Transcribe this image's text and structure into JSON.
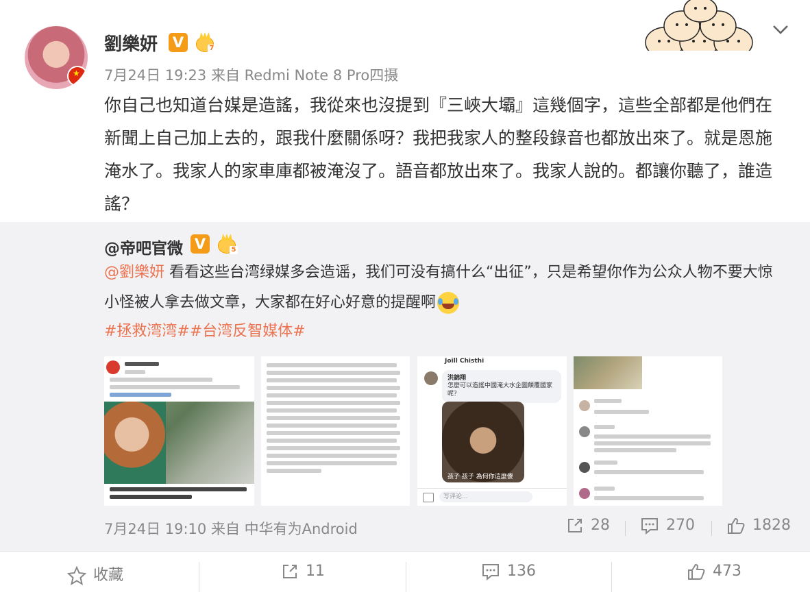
{
  "post": {
    "author": "劉樂妍",
    "level": "7",
    "time_source": "7月24日 19:23 来自 Redmi Note 8 Pro四摄",
    "text": "你自己也知道台媒是造謠，我從來也沒提到『三峽大壩』這幾個字，這些全部都是他們在新聞上自己加上去的，跟我什麼關係呀？我把我家人的整段錄音也都放出來了。就是恩施淹水了。我家人的家車庫都被淹沒了。語音都放出來了。我家人說的。都讓你聽了，誰造謠？"
  },
  "repost": {
    "author": "@帝吧官微",
    "level": "5",
    "mention": "@劉樂妍",
    "text": " 看看这些台湾绿媒多会造谣，我们可没有搞什么“出征”，只是希望你作为公众人物不要大惊小怪被人拿去做文章，大家都在好心好意的提醒啊",
    "hashtags": "#拯救湾湾##台湾反智媒体#",
    "time_source": "7月24日 19:10 来自 中华有为Android",
    "reposts": "28",
    "comments": "270",
    "likes": "1828",
    "thumb3_name": "Joill Chisthi",
    "thumb3_sender": "洪錦翔",
    "thumb3_bubble": "怎麼可以造謠中國淹大水企圖顛覆國家呢？",
    "thumb3_caption": "孩子 孩子 為何你這麼傻",
    "thumb3_input": "写评论..."
  },
  "actions": {
    "collect": "收藏",
    "reposts": "11",
    "comments": "136",
    "likes": "473"
  },
  "colors": {
    "accent": "#eb7350",
    "vbadge": "#f49b17",
    "repost_bg": "#f2f2f5"
  }
}
